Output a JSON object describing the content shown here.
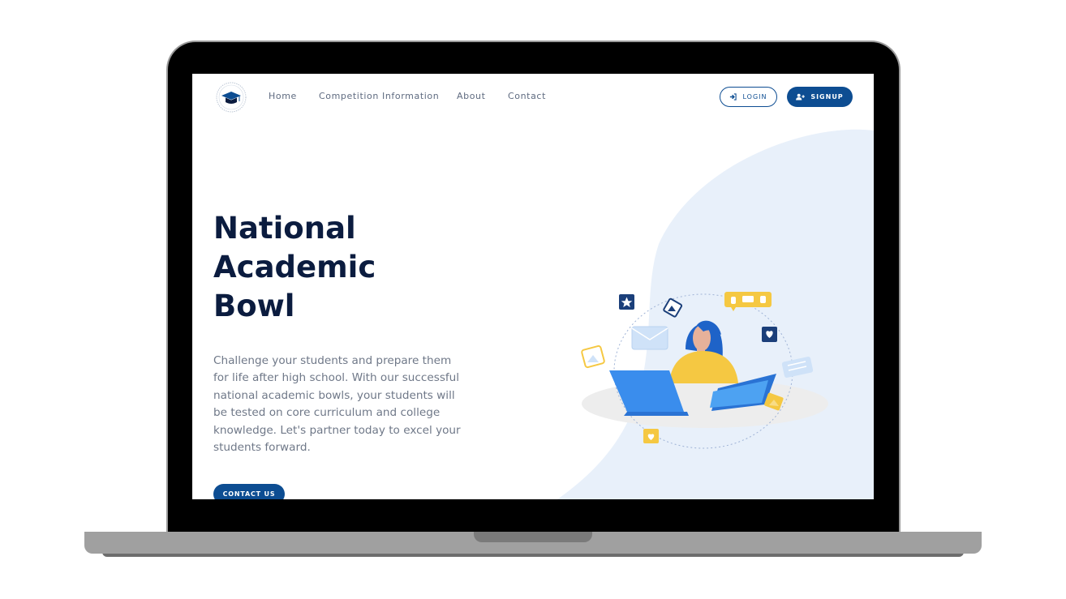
{
  "nav": {
    "links": [
      {
        "label": "Home"
      },
      {
        "label": "Competition Information"
      },
      {
        "label": "About"
      },
      {
        "label": "Contact"
      }
    ],
    "login_label": "LOGIN",
    "signup_label": "SIGNUP"
  },
  "hero": {
    "title_lines": [
      "National",
      "Academic",
      "Bowl"
    ],
    "description_lines": [
      "Challenge your students and prepare them",
      "for life after high school. With our successful",
      "national academic bowls, your students will",
      "be tested on core curriculum and college",
      "knowledge. Let's partner today to excel your",
      "students forward."
    ],
    "contact_button_label": "CONTACT US"
  },
  "colors": {
    "primary": "#0d4d92",
    "heading": "#0b1c3f",
    "blob": "#e8f0fa",
    "accent_yellow": "#f5c842"
  },
  "icons": [
    "graduation-cap-icon",
    "sign-in-icon",
    "user-plus-icon"
  ]
}
